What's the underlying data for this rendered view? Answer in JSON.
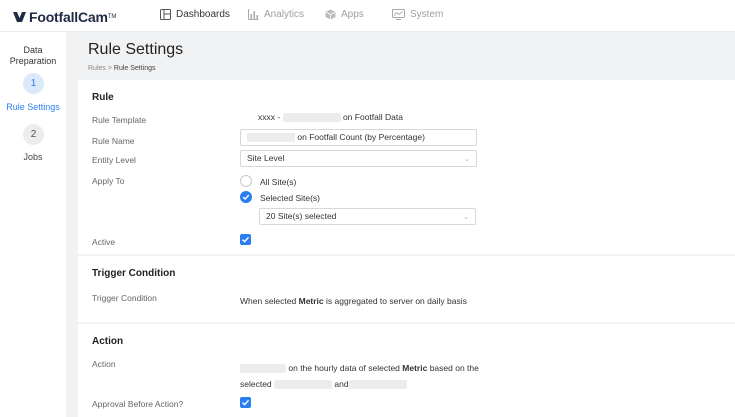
{
  "app": {
    "logo": "FootfallCam",
    "logo_mark": "TM"
  },
  "nav": [
    {
      "label": "Dashboards",
      "icon": "dashboard-icon",
      "active": true
    },
    {
      "label": "Analytics",
      "icon": "bar-chart-icon",
      "active": false
    },
    {
      "label": "Apps",
      "icon": "cube-icon",
      "active": false
    },
    {
      "label": "System",
      "icon": "monitor-icon",
      "active": false
    }
  ],
  "steps": {
    "title": "Data Preparation",
    "items": [
      {
        "number": "1",
        "label": "Rule Settings",
        "active": true
      },
      {
        "number": "2",
        "label": "Jobs",
        "active": false
      }
    ]
  },
  "page": {
    "title": "Rule Settings",
    "breadcrumb_root": "Rules",
    "breadcrumb_sep": ">",
    "breadcrumb_current": "Rule Settings"
  },
  "rule": {
    "heading": "Rule",
    "template_label": "Rule Template",
    "template_prefix": "xxxx -",
    "template_suffix": "on Footfall Data",
    "name_label": "Rule Name",
    "name_suffix": "on Footfall Count (by Percentage)",
    "entity_label": "Entity Level",
    "entity_value": "Site Level",
    "apply_label": "Apply To",
    "apply_all": "All Site(s)",
    "apply_selected": "Selected Site(s)",
    "sites_value": "20 Site(s) selected",
    "active_label": "Active"
  },
  "trigger": {
    "heading": "Trigger Condition",
    "label": "Trigger Condition",
    "text_before": "When selected",
    "text_bold": "Metric",
    "text_after": "is aggregated to server on daily basis"
  },
  "action": {
    "heading": "Action",
    "label": "Action",
    "line1_before": "on the hourly data of selected",
    "line1_bold": "Metric",
    "line1_after": "based on the",
    "line2_before": "selected",
    "line2_and": "and",
    "approval_label": "Approval Before Action?"
  },
  "colors": {
    "accent": "#2a7ef0",
    "step_active_bg": "#dbe9fb",
    "step_inactive_bg": "#ececec"
  }
}
